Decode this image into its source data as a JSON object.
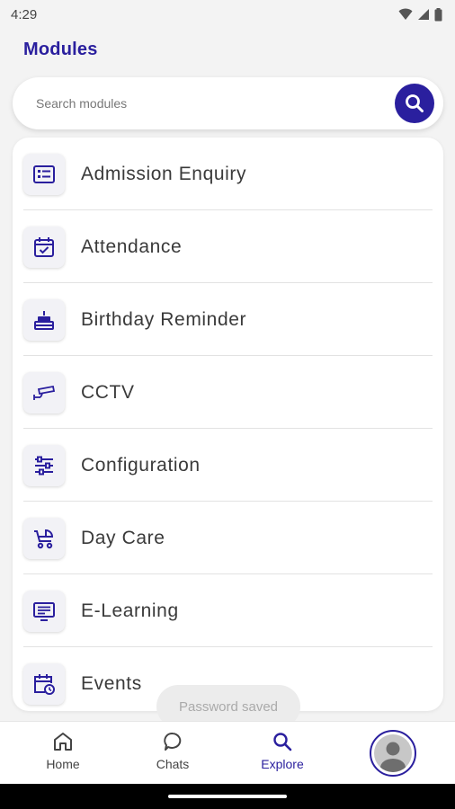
{
  "status_bar": {
    "time": "4:29",
    "icons": [
      "wifi-icon",
      "signal-icon",
      "battery-icon"
    ]
  },
  "header": {
    "title": "Modules"
  },
  "search": {
    "placeholder": "Search modules",
    "value": ""
  },
  "modules": [
    {
      "label": "Admission Enquiry",
      "icon": "list-card-icon"
    },
    {
      "label": "Attendance",
      "icon": "calendar-check-icon"
    },
    {
      "label": "Birthday Reminder",
      "icon": "cake-icon"
    },
    {
      "label": "CCTV",
      "icon": "cctv-camera-icon"
    },
    {
      "label": "Configuration",
      "icon": "sliders-icon"
    },
    {
      "label": "Day Care",
      "icon": "stroller-icon"
    },
    {
      "label": "E-Learning",
      "icon": "monitor-icon"
    },
    {
      "label": "Events",
      "icon": "calendar-clock-icon"
    }
  ],
  "toast": {
    "text": "Password saved"
  },
  "bottom_nav": {
    "items": [
      {
        "label": "Home",
        "icon": "home-icon",
        "active": false
      },
      {
        "label": "Chats",
        "icon": "chat-icon",
        "active": false
      },
      {
        "label": "Explore",
        "icon": "search-icon",
        "active": true
      }
    ],
    "profile": {
      "icon": "avatar-icon"
    }
  },
  "colors": {
    "accent": "#2a1f9e",
    "background": "#f3f3f3",
    "card": "#ffffff",
    "text": "#3a3a3a"
  }
}
